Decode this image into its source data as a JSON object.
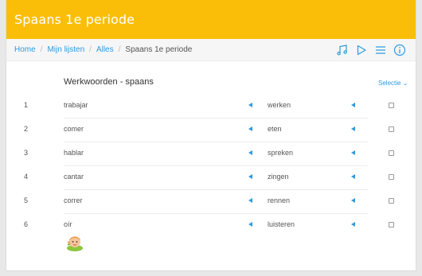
{
  "header": {
    "title": "Spaans 1e periode",
    "bg_color": "#fbbe08"
  },
  "breadcrumb": {
    "home": "Home",
    "lists": "Mijn lijsten",
    "all": "Alles",
    "current": "Spaans 1e periode",
    "separator": "/"
  },
  "toolbar_icons": [
    "music-icon",
    "play-icon",
    "menu-icon",
    "info-icon"
  ],
  "list": {
    "title": "Werkwoorden - spaans",
    "selectie_label": "Selectie",
    "rows": [
      {
        "n": "1",
        "term": "trabajar",
        "translation": "werken"
      },
      {
        "n": "2",
        "term": "comer",
        "translation": "eten"
      },
      {
        "n": "3",
        "term": "hablar",
        "translation": "spreken"
      },
      {
        "n": "4",
        "term": "cantar",
        "translation": "zingen"
      },
      {
        "n": "5",
        "term": "correr",
        "translation": "rennen"
      },
      {
        "n": "6",
        "term": "oír",
        "translation": "luisteren"
      }
    ]
  },
  "accent_color": "#2d9be0"
}
